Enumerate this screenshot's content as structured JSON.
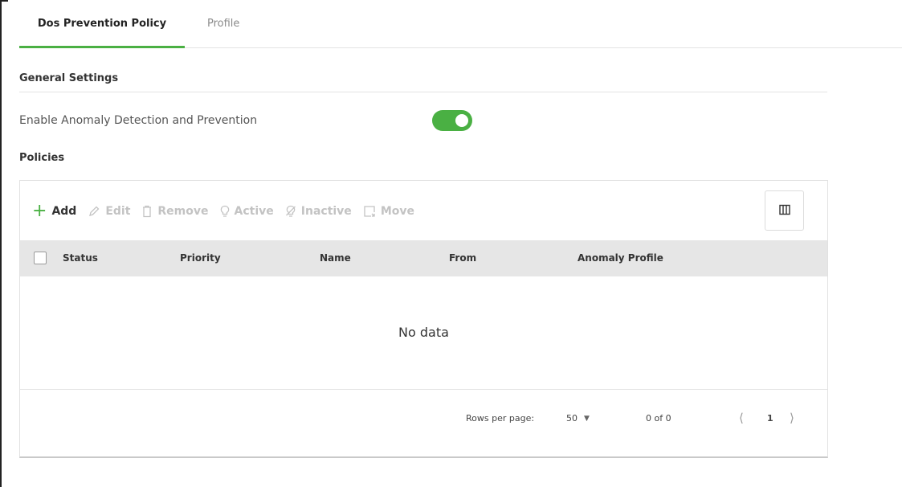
{
  "tabs": [
    {
      "label": "Dos Prevention Policy",
      "active": true
    },
    {
      "label": "Profile",
      "active": false
    }
  ],
  "general_settings": {
    "title": "General Settings",
    "enable_label": "Enable Anomaly Detection and Prevention",
    "enabled": true
  },
  "policies": {
    "title": "Policies",
    "toolbar": {
      "add": "Add",
      "edit": "Edit",
      "remove": "Remove",
      "active": "Active",
      "inactive": "Inactive",
      "move": "Move"
    },
    "columns": [
      "Status",
      "Priority",
      "Name",
      "From",
      "Anomaly Profile"
    ],
    "empty_text": "No data",
    "pagination": {
      "rows_per_page_label": "Rows per page:",
      "rows_per_page": "50",
      "range": "0 of 0",
      "page": "1"
    }
  },
  "colors": {
    "accent": "#4ab043",
    "header_bg": "#e6e6e6"
  }
}
